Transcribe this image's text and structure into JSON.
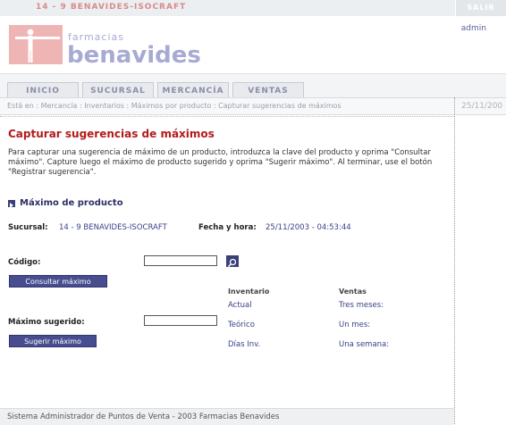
{
  "header": {
    "store": "14 - 9    BENAVIDES-ISOCRAFT",
    "exit_label": "SALIR",
    "logo_line1": "farmacias",
    "logo_line2": "benavides",
    "user": "admin"
  },
  "tabs": [
    {
      "label": "INICIO"
    },
    {
      "label": "SUCURSAL"
    },
    {
      "label": "MERCANCÍA"
    },
    {
      "label": "VENTAS"
    }
  ],
  "breadcrumb": {
    "path": "Está en : Mercancía : Inventarios : Máximos por producto : Capturar sugerencias de máximos",
    "date": "25/11/200"
  },
  "page": {
    "title": "Capturar sugerencias de máximos",
    "intro": "Para capturar una sugerencia de máximo de un producto, introduzca la clave del producto y oprima \"Consultar máximo\". Capture luego el máximo de producto sugerido y oprima \"Sugerir máximo\". Al terminar, use el botón \"Registrar sugerencia\"."
  },
  "section": {
    "title": "Máximo de producto",
    "branch_label": "Sucursal:",
    "branch_value": "14 - 9  BENAVIDES-ISOCRAFT",
    "datetime_label": "Fecha y hora:",
    "datetime_value": "25/11/2003 - 04:53:44"
  },
  "form": {
    "code_label": "Código:",
    "code_value": "",
    "consult_button": "Consultar máximo",
    "suggested_label": "Máximo sugerido:",
    "suggested_value": "",
    "suggest_button": "Sugerir máximo"
  },
  "inventory": {
    "heading": "Inventario",
    "items": [
      "Actual",
      "Teórico",
      "Días Inv."
    ]
  },
  "sales": {
    "heading": "Ventas",
    "items": [
      "Tres meses:",
      "Un mes:",
      "Una semana:"
    ]
  },
  "footer": {
    "text": "Sistema Administrador de Puntos de Venta - 2003 Farmacias Benavides"
  },
  "colors": {
    "brand_red": "#b31b1b",
    "brand_blue": "#3a3f8a",
    "button": "#474d8f"
  }
}
